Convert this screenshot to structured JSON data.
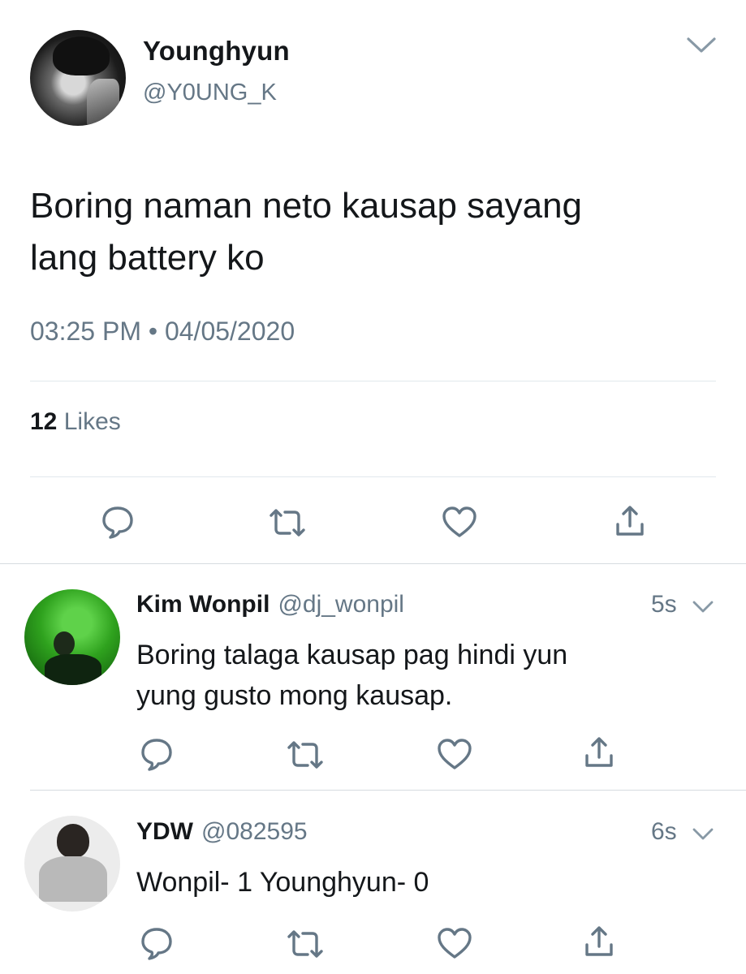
{
  "main_tweet": {
    "display_name": "Younghyun",
    "handle": "@Y0UNG_K",
    "text_line1": "Boring naman neto kausap sayang",
    "text_line2": "lang battery ko",
    "timestamp": "03:25 PM • 04/05/2020",
    "likes_count": "12",
    "likes_label": "Likes"
  },
  "replies": [
    {
      "display_name": "Kim Wonpil",
      "handle": "@dj_wonpil",
      "time": "5s",
      "text_line1": "Boring talaga kausap pag hindi yun",
      "text_line2": "yung gusto mong kausap."
    },
    {
      "display_name": "YDW",
      "handle": "@082595",
      "time": "6s",
      "text_line1": "Wonpil- 1 Younghyun- 0",
      "text_line2": ""
    }
  ],
  "icons": {
    "reply": "reply-icon",
    "retweet": "retweet-icon",
    "like": "heart-icon",
    "share": "share-icon",
    "menu": "chevron-down-icon"
  },
  "colors": {
    "text": "#14171a",
    "secondary": "#657786",
    "icon": "#657786",
    "divider": "#e1e8ed"
  }
}
